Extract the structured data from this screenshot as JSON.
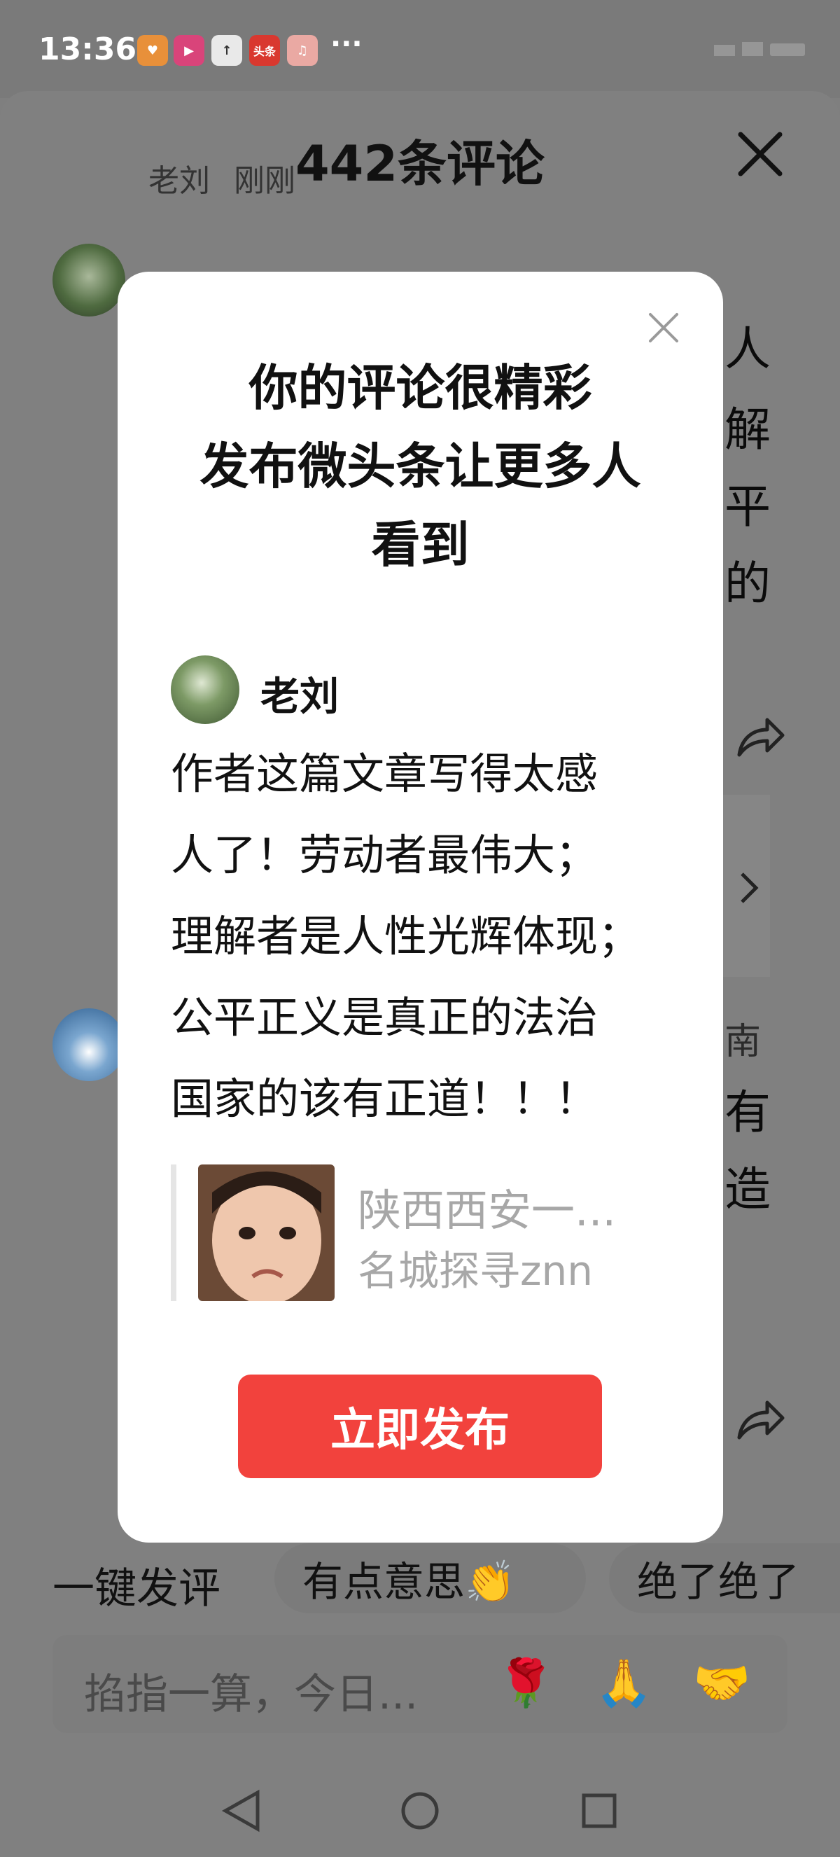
{
  "status_bar": {
    "time": "13:36",
    "more": "···",
    "app_icons": [
      "heart-app-icon",
      "play-app-icon",
      "upload-icon",
      "toutiao-app-icon",
      "music-app-icon"
    ],
    "toutiao_label": "头条"
  },
  "sheet": {
    "title": "442条评论",
    "comment_user": "老刘",
    "comment_time": "刚刚",
    "right_chars": [
      "人",
      "解",
      "平",
      "的"
    ],
    "right_chars_2": [
      "南",
      "有",
      "造"
    ]
  },
  "quick_comment": {
    "label": "一键发评",
    "chips": [
      "有点意思👏",
      "绝了绝了"
    ]
  },
  "input": {
    "placeholder": "掐指一算，今日...",
    "emojis": [
      "🌹",
      "🙏",
      "🤝"
    ]
  },
  "modal": {
    "title_lines": [
      "你的评论很精彩",
      "发布微头条让更多人",
      "看到"
    ],
    "username": "老刘",
    "comment_lines": [
      "作者这篇文章写得太感",
      "人了！劳动者最伟大；",
      "理解者是人性光辉体现；",
      "公平正义是真正的法治",
      "国家的该有正道！！！"
    ],
    "quote_title": "陕西西安一...",
    "quote_author": "名城探寻znn",
    "publish_button": "立即发布"
  },
  "colors": {
    "accent": "#f2423d",
    "overlay": "#7f7f7f",
    "quote_text": "#a7a7a7"
  }
}
